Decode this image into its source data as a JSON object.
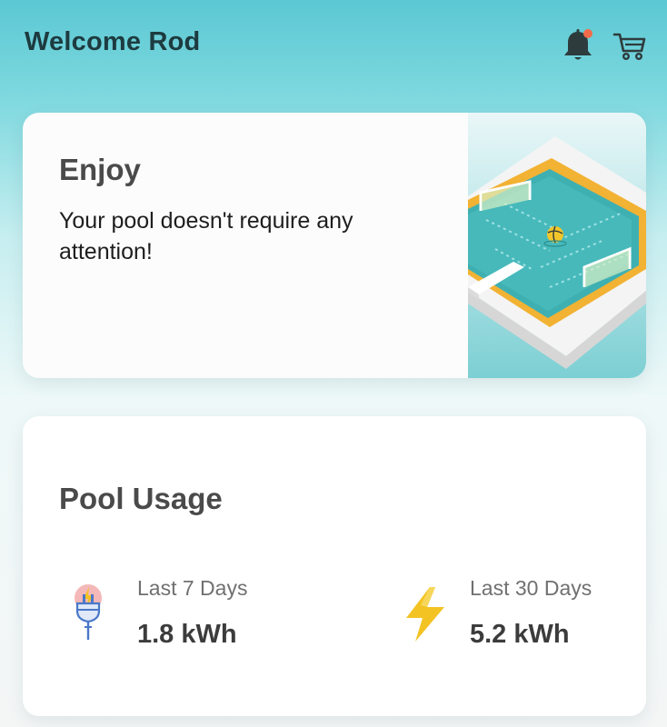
{
  "header": {
    "title": "Welcome Rod",
    "notification_icon": "bell-icon",
    "cart_icon": "cart-icon",
    "notification_dot_color": "#f26b4a"
  },
  "status_card": {
    "title": "Enjoy",
    "message": "Your pool doesn't require any attention!",
    "illustration": "pool-illustration"
  },
  "usage_card": {
    "title": "Pool Usage",
    "stats": [
      {
        "label": "Last 7 Days",
        "value": "1.8 kWh",
        "icon": "plug-icon"
      },
      {
        "label": "Last 30 Days",
        "value": "5.2 kWh",
        "icon": "lightning-bolt-icon"
      }
    ]
  },
  "colors": {
    "header_gradient_top": "#5bc8d3",
    "title_text": "#1d3b40",
    "pool_water": "#3fb0b2",
    "pool_rim": "#f2b233",
    "bolt": "#f3c323"
  }
}
